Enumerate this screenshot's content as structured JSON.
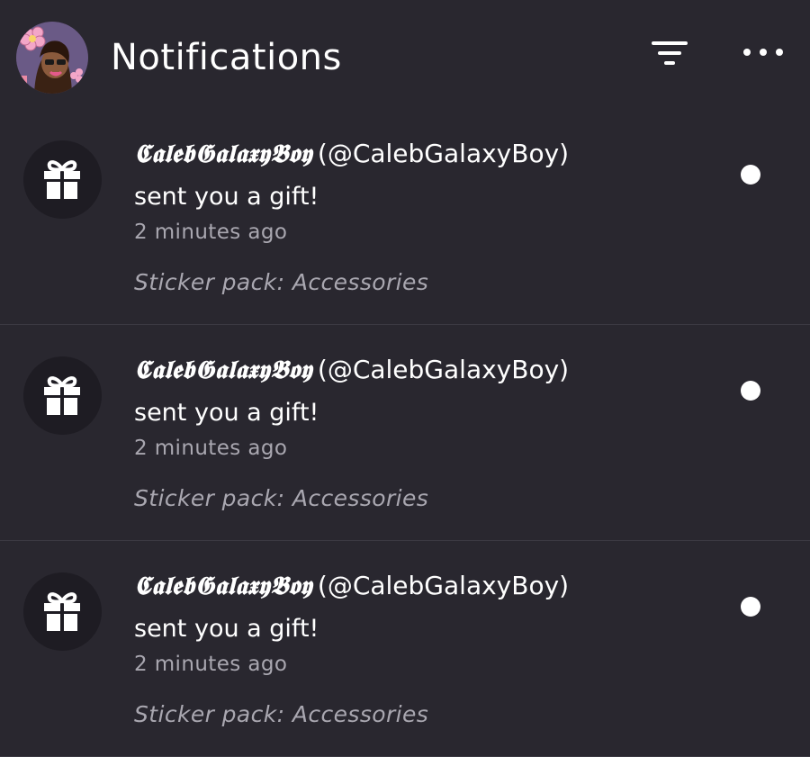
{
  "header": {
    "title": "Notifications",
    "avatar_icon": "user-avatar",
    "filter_icon": "filter-icon",
    "more_icon": "more-horizontal-icon"
  },
  "notifications": [
    {
      "display_name": "𝕮𝖆𝖑𝖊𝖇𝕲𝖆𝖑𝖆𝖝𝖞𝕭𝖔𝖞",
      "handle": "(@CalebGalaxyBoy)",
      "message": "sent you a gift!",
      "time": "2 minutes ago",
      "detail": "Sticker pack: Accessories",
      "icon": "gift-icon",
      "unread": true
    },
    {
      "display_name": "𝕮𝖆𝖑𝖊𝖇𝕲𝖆𝖑𝖆𝖝𝖞𝕭𝖔𝖞",
      "handle": "(@CalebGalaxyBoy)",
      "message": "sent you a gift!",
      "time": "2 minutes ago",
      "detail": "Sticker pack: Accessories",
      "icon": "gift-icon",
      "unread": true
    },
    {
      "display_name": "𝕮𝖆𝖑𝖊𝖇𝕲𝖆𝖑𝖆𝖝𝖞𝕭𝖔𝖞",
      "handle": "(@CalebGalaxyBoy)",
      "message": "sent you a gift!",
      "time": "2 minutes ago",
      "detail": "Sticker pack: Accessories",
      "icon": "gift-icon",
      "unread": true
    }
  ],
  "colors": {
    "background": "#29272f",
    "icon_circle": "#1e1c23",
    "secondary_text": "#a9a7b0",
    "divider": "#3b3942"
  }
}
